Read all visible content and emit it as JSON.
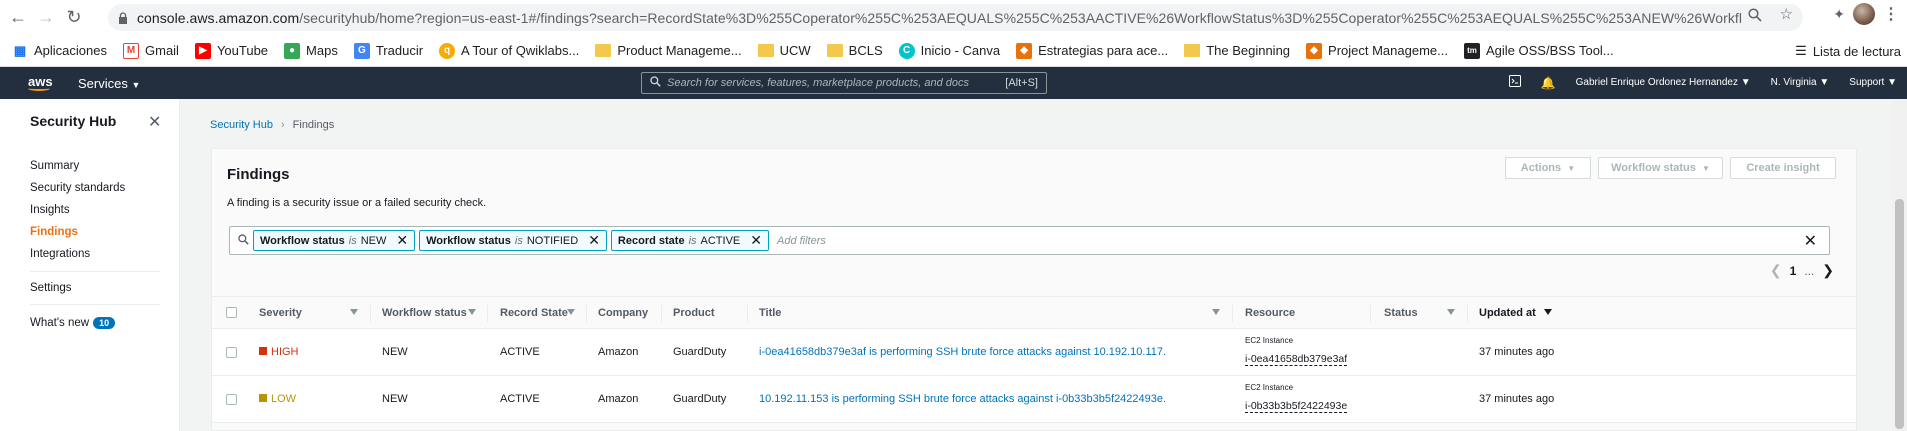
{
  "browser": {
    "url_host": "console.aws.amazon.com",
    "url_path": "/securityhub/home?region=us-east-1#/findings?search=RecordState%3D%255Coperator%255C%253AEQUALS%255C%253AACTIVE%26WorkflowStatus%3D%255Coperator%255C%253AEQUALS%255C%253ANEW%26WorkflowStat...",
    "bookmarks": [
      {
        "label": "Aplicaciones",
        "icon": "apps-grid-icon"
      },
      {
        "label": "Gmail",
        "icon": "gmail-icon"
      },
      {
        "label": "YouTube",
        "icon": "youtube-icon"
      },
      {
        "label": "Maps",
        "icon": "maps-icon"
      },
      {
        "label": "Traducir",
        "icon": "translate-icon"
      },
      {
        "label": "A Tour of Qwiklabs...",
        "icon": "qwiklabs-icon"
      },
      {
        "label": "Product Manageme...",
        "icon": "folder-icon"
      },
      {
        "label": "UCW",
        "icon": "folder-icon"
      },
      {
        "label": "BCLS",
        "icon": "folder-icon"
      },
      {
        "label": "Inicio - Canva",
        "icon": "canva-icon"
      },
      {
        "label": "Estrategias para ace...",
        "icon": "bookmark-icon"
      },
      {
        "label": "The Beginning",
        "icon": "folder-icon"
      },
      {
        "label": "Project Manageme...",
        "icon": "bookmark-icon"
      },
      {
        "label": "Agile OSS/BSS Tool...",
        "icon": "tm-icon"
      }
    ],
    "reading_list": "Lista de lectura"
  },
  "aws_nav": {
    "logo": "aws",
    "services": "Services",
    "search_placeholder": "Search for services, features, marketplace products, and docs",
    "search_shortcut": "[Alt+S]",
    "user": "Gabriel Enrique Ordonez Hernandez",
    "region": "N. Virginia",
    "support": "Support"
  },
  "sidebar": {
    "title": "Security Hub",
    "items": [
      {
        "label": "Summary",
        "active": false
      },
      {
        "label": "Security standards",
        "active": false
      },
      {
        "label": "Insights",
        "active": false
      },
      {
        "label": "Findings",
        "active": true
      },
      {
        "label": "Integrations",
        "active": false
      },
      {
        "label": "Settings",
        "active": false
      }
    ],
    "whats_new": "What's new",
    "whats_new_count": "10"
  },
  "breadcrumb": {
    "root": "Security Hub",
    "current": "Findings"
  },
  "findings": {
    "title": "Findings",
    "description": "A finding is a security issue or a failed security check.",
    "actions_label": "Actions",
    "workflow_status_label": "Workflow status",
    "create_insight_label": "Create insight",
    "filters": [
      {
        "field": "Workflow status",
        "op": "is",
        "value": "NEW"
      },
      {
        "field": "Workflow status",
        "op": "is",
        "value": "NOTIFIED"
      },
      {
        "field": "Record state",
        "op": "is",
        "value": "ACTIVE"
      }
    ],
    "add_filters_placeholder": "Add filters",
    "pagination": {
      "current": "1",
      "more": "..."
    },
    "columns": {
      "severity": "Severity",
      "workflow_status": "Workflow status",
      "record_state": "Record State",
      "company": "Company",
      "product": "Product",
      "title": "Title",
      "resource": "Resource",
      "status": "Status",
      "updated_at": "Updated at"
    },
    "rows": [
      {
        "severity": "HIGH",
        "severity_color": "#d13212",
        "workflow_status": "NEW",
        "record_state": "ACTIVE",
        "company": "Amazon",
        "product": "GuardDuty",
        "title": "i-0ea41658db379e3af is performing SSH brute force attacks against 10.192.10.117.",
        "resource_type": "EC2 Instance",
        "resource_id": "i-0ea41658db379e3af",
        "status": "",
        "updated_at": "37 minutes ago"
      },
      {
        "severity": "LOW",
        "severity_color": "#b7950b",
        "workflow_status": "NEW",
        "record_state": "ACTIVE",
        "company": "Amazon",
        "product": "GuardDuty",
        "title": "10.192.11.153 is performing SSH brute force attacks against i-0b33b3b5f2422493e.",
        "resource_type": "EC2 Instance",
        "resource_id": "i-0b33b3b5f2422493e",
        "status": "",
        "updated_at": "37 minutes ago"
      }
    ]
  },
  "colors": {
    "aws_nav_bg": "#232f3e",
    "accent_orange": "#ec7211",
    "link_blue": "#0073bb",
    "filter_chip_border": "#00a1c9"
  }
}
